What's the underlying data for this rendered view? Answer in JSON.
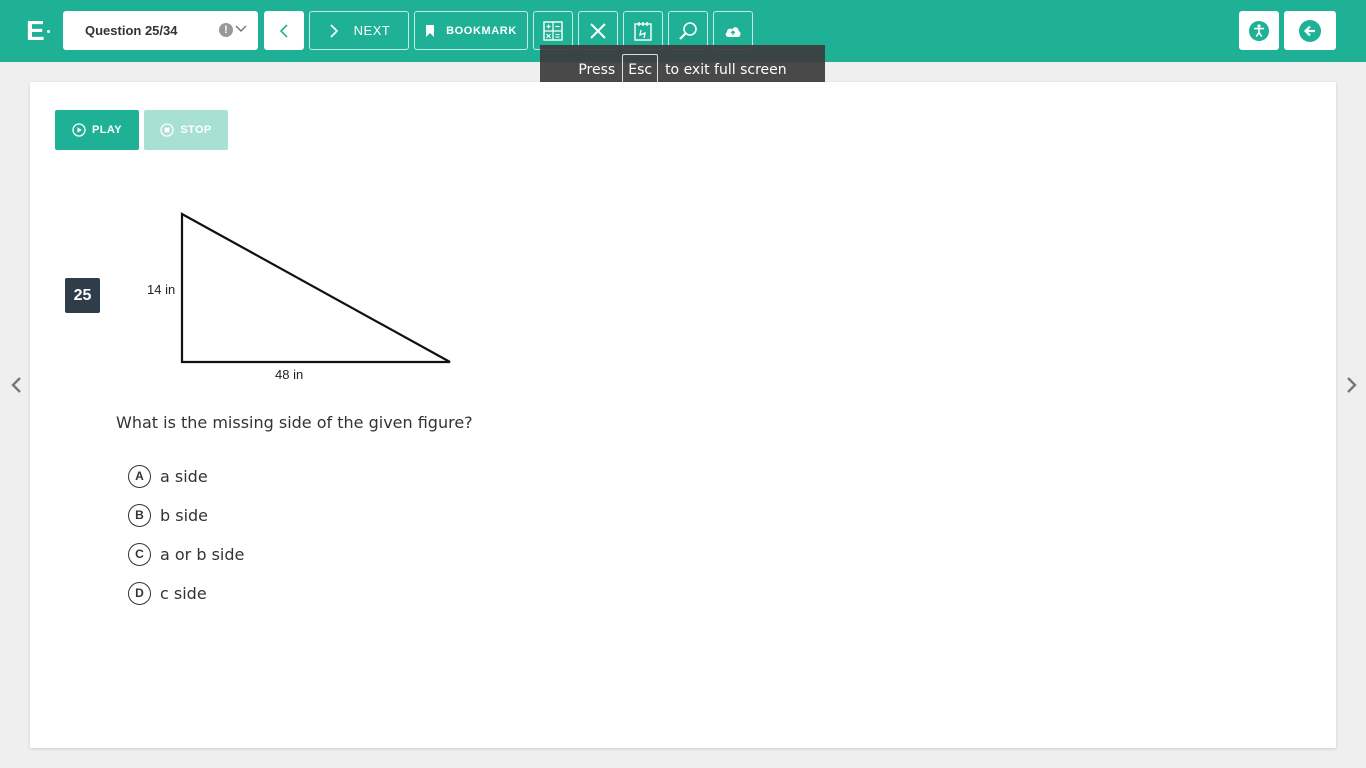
{
  "header": {
    "logo_letter": "E",
    "question_selector": "Question 25/34",
    "warning_mark": "!",
    "next_label": "NEXT",
    "bookmark_label": "BOOKMARK",
    "tool_icons": [
      "calculator-icon",
      "close-icon",
      "notepad-icon",
      "magnifier-icon",
      "cloud-upload-icon"
    ],
    "accessibility_icon": "accessibility-icon",
    "exit_icon": "arrow-left-circle-icon"
  },
  "fullscreen_toast": {
    "prefix": "Press",
    "key": "Esc",
    "suffix": "to exit full screen"
  },
  "audio": {
    "play_label": "PLAY",
    "stop_label": "STOP"
  },
  "question": {
    "number": "25",
    "figure": {
      "height_label": "14 in",
      "base_label": "48 in"
    },
    "prompt": "What is the missing side of the given figure?",
    "choices": [
      {
        "letter": "A",
        "text": "a side"
      },
      {
        "letter": "B",
        "text": "b side"
      },
      {
        "letter": "C",
        "text": "a or b side"
      },
      {
        "letter": "D",
        "text": "c side"
      }
    ]
  },
  "colors": {
    "brand": "#1eb195",
    "brand_disabled": "#a8e0d4",
    "badge": "#2f3d4a"
  }
}
